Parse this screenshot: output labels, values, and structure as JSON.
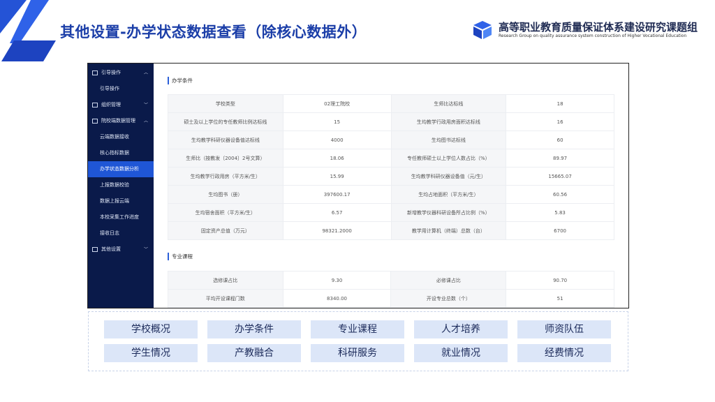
{
  "header": {
    "title": "其他设置-办学状态数据查看（除核心数据外）",
    "logo_cn": "高等职业教育质量保证体系建设研究课题组",
    "logo_en": "Research Group on quality assurance system construction of Higher Vocational Education"
  },
  "colors": {
    "brand": "#1b3ea8",
    "sidebar": "#0a1a4a",
    "active": "#1f56d6",
    "tag": "#dce6f8"
  },
  "sidebar": {
    "items": [
      {
        "label": "引导操作",
        "type": "group"
      },
      {
        "label": "引导操作",
        "type": "item"
      },
      {
        "label": "组织管理",
        "type": "group"
      },
      {
        "label": "院校端数据管理",
        "type": "group"
      },
      {
        "label": "云端数据接收",
        "type": "item"
      },
      {
        "label": "核心指标数据",
        "type": "item"
      },
      {
        "label": "办学状态数据分析",
        "type": "item",
        "active": true
      },
      {
        "label": "上报数据校验",
        "type": "item"
      },
      {
        "label": "数据上报云端",
        "type": "item"
      },
      {
        "label": "本校采集工作进度",
        "type": "item"
      },
      {
        "label": "接收日志",
        "type": "item"
      },
      {
        "label": "其他设置",
        "type": "group"
      }
    ]
  },
  "conditions": {
    "title": "办学条件",
    "rows": [
      [
        "学校类型",
        "02理工院校",
        "生师比达标线",
        "18"
      ],
      [
        "硕士及以上学位的专任教师比例达标线",
        "15",
        "生均教学行政用房面积达标线",
        "16"
      ],
      [
        "生均教学科研仪器设备值达标线",
        "4000",
        "生均图书达标线",
        "60"
      ],
      [
        "生师比（按教发〔2004〕2号文算）",
        "18.06",
        "专任教师硕士以上学位人数占比（%）",
        "89.97"
      ],
      [
        "生均教学行政用房（平方米/生）",
        "15.99",
        "生均教学科研仪器设备值（元/生）",
        "15665.07"
      ],
      [
        "生均图书（册）",
        "397600.17",
        "生均占地面积（平方米/生）",
        "60.56"
      ],
      [
        "生均宿舍面积（平方米/生）",
        "6.57",
        "新增教学仪器科研设备所占比例（%）",
        "5.83"
      ],
      [
        "固定资产总值（万元）",
        "98321.2000",
        "教学用计算机（终端）总数（台）",
        "6700"
      ]
    ]
  },
  "courses": {
    "title": "专业课程",
    "rows": [
      [
        "选修课占比",
        "9.30",
        "必修课占比",
        "90.70"
      ],
      [
        "平均开设课程门数",
        "8340.00",
        "开设专业总数（个）",
        "51"
      ]
    ]
  },
  "tags": [
    "学校概况",
    "办学条件",
    "专业课程",
    "人才培养",
    "师资队伍",
    "学生情况",
    "产教融合",
    "科研服务",
    "就业情况",
    "经费情况"
  ]
}
